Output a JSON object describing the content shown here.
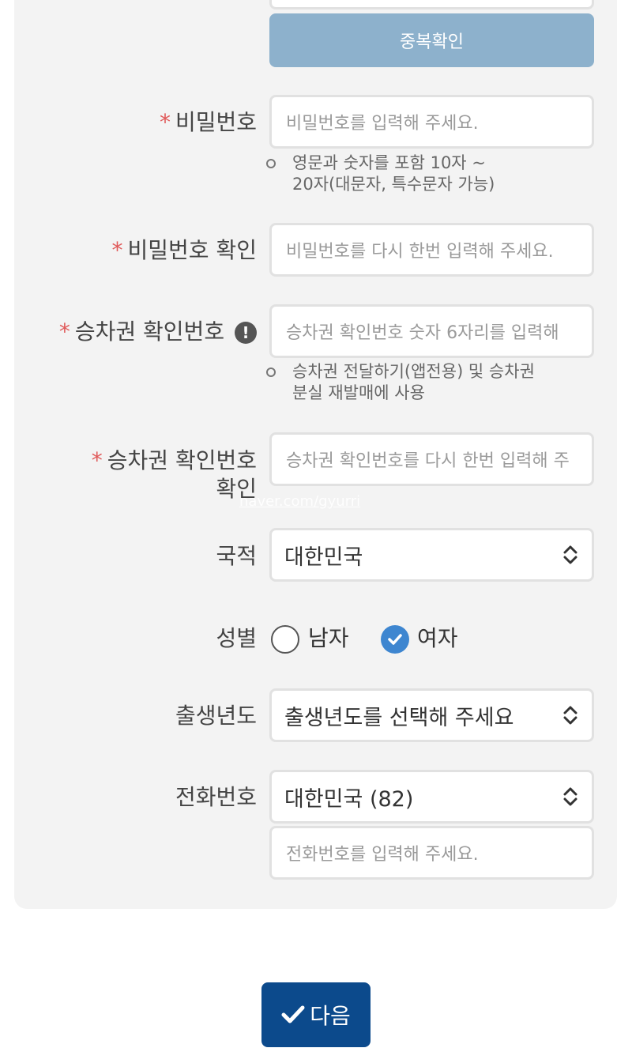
{
  "top_field": {
    "value": ""
  },
  "duplicate_check": {
    "label": "중복확인"
  },
  "password": {
    "required": "*",
    "label": "비밀번호",
    "placeholder": "비밀번호를 입력해 주세요.",
    "hint": [
      "영문과 숫자를 포함 10자 ~",
      "20자(대문자, 특수문자 가능)"
    ]
  },
  "password_confirm": {
    "required": "*",
    "label": "비밀번호 확인",
    "placeholder": "비밀번호를 다시 한번 입력해 주세요."
  },
  "ticket_pin": {
    "required": "*",
    "label": "승차권 확인번호",
    "info_icon": "!",
    "placeholder": "승차권 확인번호 숫자 6자리를 입력해",
    "hint": [
      "승차권 전달하기(앱전용) 및 승차권",
      "분실 재발매에 사용"
    ]
  },
  "ticket_pin_confirm": {
    "required": "*",
    "label_line1": "승차권 확인번호",
    "label_line2": "확인",
    "placeholder": "승차권 확인번호를 다시 한번 입력해 주"
  },
  "watermark": "naver.com/gyurri",
  "nationality": {
    "label": "국적",
    "selected": "대한민국"
  },
  "gender": {
    "label": "성별",
    "options": [
      {
        "label": "남자",
        "checked": false
      },
      {
        "label": "여자",
        "checked": true
      }
    ]
  },
  "birth_year": {
    "label": "출생년도",
    "selected": "출생년도를 선택해 주세요"
  },
  "phone": {
    "label": "전화번호",
    "country_selected": "대한민국 (82)",
    "placeholder": "전화번호를 입력해 주세요."
  },
  "next_button": {
    "label": "다음"
  },
  "colors": {
    "accent": "#3e86d0",
    "primary_button": "#0c4a8c",
    "disabled_button": "#8db1cc",
    "required": "#e05a5a"
  }
}
